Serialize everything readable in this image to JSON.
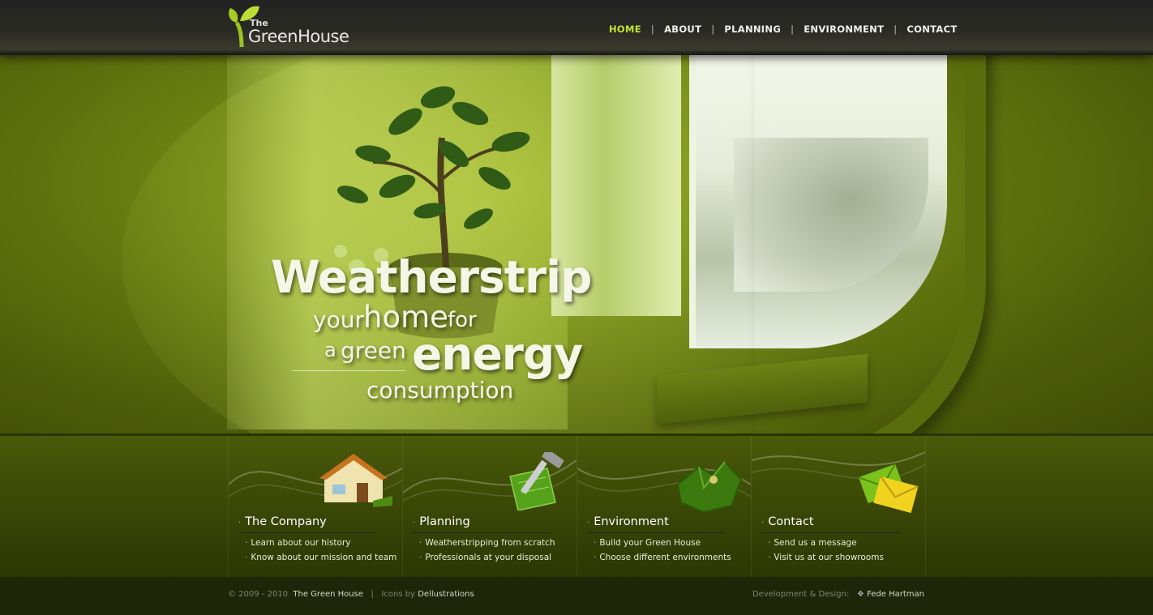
{
  "brand": {
    "the": "The",
    "name": "GreenHouse"
  },
  "nav": [
    {
      "label": "HOME",
      "active": true
    },
    {
      "label": "ABOUT"
    },
    {
      "label": "PLANNING"
    },
    {
      "label": "ENVIRONMENT"
    },
    {
      "label": "CONTACT"
    }
  ],
  "nav_separator": "|",
  "hero": {
    "line1": "Weatherstrip",
    "line2_a": "your",
    "line2_b": "home",
    "line2_c": "for",
    "line3_a": "a",
    "line3_b": "green",
    "line3_c": "energy",
    "line4": "consumption"
  },
  "features": [
    {
      "title": "The Company",
      "icon": "house-icon",
      "links": [
        "Learn about our history",
        "Know about our mission and team"
      ]
    },
    {
      "title": "Planning",
      "icon": "blueprint-hammer-icon",
      "links": [
        "Weatherstripping from scratch",
        "Professionals at your disposal"
      ]
    },
    {
      "title": "Environment",
      "icon": "landscape-icon",
      "links": [
        "Build your Green House",
        "Choose different environments"
      ]
    },
    {
      "title": "Contact",
      "icon": "envelope-icon",
      "links": [
        "Send us a message",
        "Visit us at our showrooms"
      ]
    }
  ],
  "footer": {
    "copyright": "© 2009 - 2010",
    "site_name": "The Green House",
    "separator": "|",
    "icons_by": "Icons by",
    "icons_author": "Dellustrations",
    "dev_label": "Development & Design:",
    "dev_name": "Fede Hartman"
  },
  "colors": {
    "accent": "#c6e32a",
    "brand_green": "#6b7f12",
    "footer_bg": "#1f2509"
  }
}
